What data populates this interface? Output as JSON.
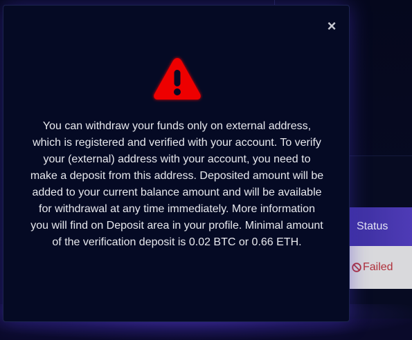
{
  "modal": {
    "close_label": "×",
    "icon": "warning-triangle-icon",
    "icon_color": "#ee0000",
    "message": "You can withdraw your funds only on external address, which is registered and verified with your account. To verify your (external) address with your account, you need to make a deposit from this address. Deposited amount will be added to your current balance amount and will be available for withdrawal at any time immediately. More information you will find on Deposit area in your profile. Minimal amount of the verification deposit is 0.02 BTC or 0.66 ETH."
  },
  "background_table": {
    "header": "Status",
    "rows": [
      {
        "status": "Failed",
        "status_icon": "ban-icon",
        "status_color": "#b0303b"
      }
    ]
  },
  "colors": {
    "page_bg": "#05081d",
    "modal_bg": "#050a24",
    "header_bg": "#4e3bb6",
    "cell_bg": "#d9d9dc"
  }
}
